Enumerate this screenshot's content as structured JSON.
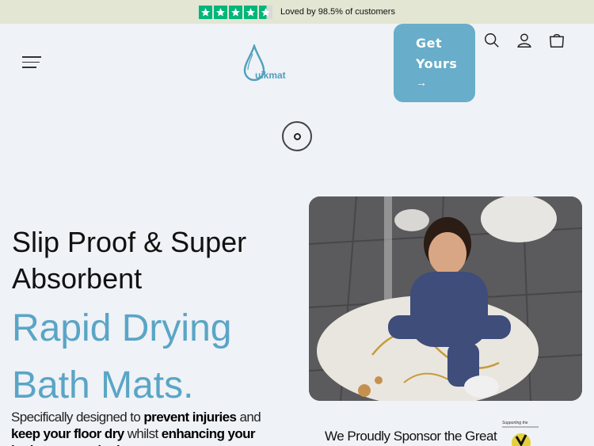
{
  "announcement": {
    "rating_stars": 4.5,
    "text": "Loved by 98.5% of customers"
  },
  "header": {
    "logo_text": "uikmat",
    "cta": {
      "label": "Get Yours",
      "arrow": "→"
    },
    "icons": [
      "search-icon",
      "account-icon",
      "cart-icon"
    ]
  },
  "hero": {
    "title_line1": "Slip Proof & Super",
    "title_line2": "Absorbent",
    "accent_line1": "Rapid Drying",
    "accent_line2": "Bath Mats.",
    "description": {
      "p1": "Specifically designed to ",
      "b1": "prevent injuries",
      "p2": " and ",
      "b2": "keep your floor dry",
      "p3": " whilst ",
      "b3": "enhancing",
      "b4": "your bathroom aesthetic"
    }
  },
  "sponsor": {
    "text": "We Proudly Sponsor the Great",
    "badge_text": "Supporting the"
  },
  "colors": {
    "announce_bg": "#e2e6d2",
    "page_bg": "#eff2f6",
    "accent": "#5aa5c6",
    "cta_bg": "#68adc9",
    "star": "#00b67a"
  }
}
